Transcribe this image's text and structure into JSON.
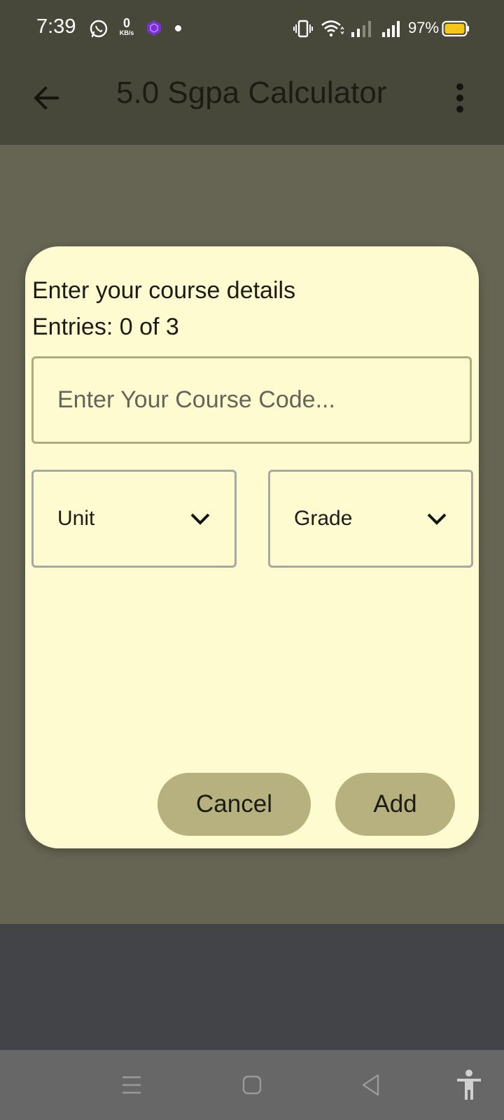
{
  "status_bar": {
    "time": "7:39",
    "net_speed_value": "0",
    "net_speed_unit": "KB/s",
    "battery_percent": "97%",
    "icons": [
      "whatsapp-icon",
      "app-notification-icon",
      "notification-dot-icon",
      "vibrate-icon",
      "wifi-icon",
      "signal-sim1-icon",
      "signal-sim2-icon",
      "battery-icon"
    ]
  },
  "app_bar": {
    "title": "5.0 Sgpa Calculator",
    "back_icon": "arrow-back-icon",
    "menu_icon": "more-vert-icon"
  },
  "dialog": {
    "title": "Enter your course details",
    "entries_text": "Entries: 0 of 3",
    "course_code": {
      "value": "",
      "placeholder": "Enter Your Course Code..."
    },
    "unit_dropdown": {
      "selected": "Unit"
    },
    "grade_dropdown": {
      "selected": "Grade"
    },
    "cancel_label": "Cancel",
    "add_label": "Add"
  },
  "fab": {
    "icon": "plus-icon"
  },
  "nav_bar": {
    "icons": [
      "recents-icon",
      "home-icon",
      "back-triangle-icon",
      "accessibility-icon"
    ]
  },
  "colors": {
    "app_bar": "#48483a",
    "scrim_content": "#666554",
    "dialog_bg": "#fffbd1",
    "button_bg": "#b6b17e",
    "input_border": "#aeaa83",
    "battery_fill": "#f5c518",
    "app_icon_purple": "#7b2fd0"
  }
}
